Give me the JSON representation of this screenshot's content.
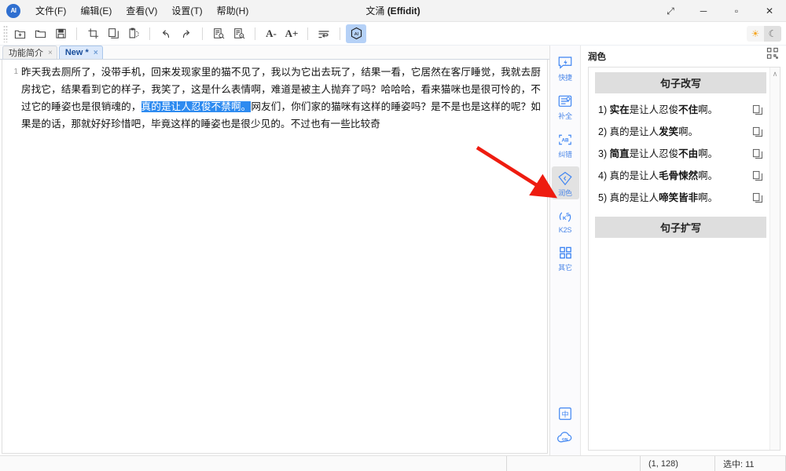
{
  "window": {
    "title_cn": "文涌",
    "title_en": "(Effidit)",
    "logo_text": "AI",
    "controls": {
      "expand": "⤢",
      "minimize": "─",
      "maximize": "▫",
      "close": "✕"
    }
  },
  "menubar": {
    "items": [
      {
        "label": "文件(F)"
      },
      {
        "label": "编辑(E)"
      },
      {
        "label": "查看(V)"
      },
      {
        "label": "设置(T)"
      },
      {
        "label": "帮助(H)"
      }
    ]
  },
  "toolbar": {
    "buttons": [
      {
        "name": "new-file-icon",
        "glyph": "icon-newfile"
      },
      {
        "name": "open-folder-icon",
        "glyph": "icon-open"
      },
      {
        "name": "save-icon",
        "glyph": "icon-save"
      },
      {
        "name": "cut-icon",
        "glyph": "icon-cut"
      },
      {
        "name": "copy-icon",
        "glyph": "icon-copy"
      },
      {
        "name": "paste-icon",
        "glyph": "icon-paste"
      },
      {
        "name": "undo-icon",
        "glyph": "icon-undo"
      },
      {
        "name": "redo-icon",
        "glyph": "icon-redo"
      },
      {
        "name": "find-icon",
        "glyph": "icon-find"
      },
      {
        "name": "replace-icon",
        "glyph": "icon-replace"
      },
      {
        "name": "font-decrease-icon",
        "glyph": "A-"
      },
      {
        "name": "font-increase-icon",
        "glyph": "A+"
      },
      {
        "name": "wrap-text-icon",
        "glyph": "icon-wrap"
      },
      {
        "name": "ai-assist-icon",
        "glyph": "icon-ai"
      }
    ],
    "theme": {
      "light": "☀",
      "dark": "☾"
    },
    "qr_corner": "qr-icon"
  },
  "tabs": [
    {
      "label": "功能简介",
      "active": false,
      "dirty": false,
      "close": "×"
    },
    {
      "label": "New *",
      "active": true,
      "dirty": true,
      "close": "×"
    }
  ],
  "editor": {
    "line_number": "1",
    "paragraph": {
      "before_selection": "昨天我去厕所了，没带手机，回来发现家里的猫不见了，我以为它出去玩了，结果一看，它居然在客厅睡觉，我就去厨房找它，结果看到它的样子，我笑了，这是什么表情啊，难道是被主人抛弃了吗？哈哈哈，看来猫咪也是很可怜的，不过它的睡姿也是很销魂的，",
      "selection": "真的是让人忍俊不禁啊。",
      "after_selection": "网友们，你们家的猫咪有这样的睡姿吗？是不是也是这样的呢？如果是的话，那就好好珍惜吧，毕竟这样的睡姿也是很少见的。不过也有一些比较奇"
    },
    "selection_color": "#2e8bf0"
  },
  "right_rail": {
    "items": [
      {
        "label": "快捷",
        "icon": "lightning-card-icon",
        "active": false
      },
      {
        "label": "补全",
        "icon": "autocomplete-icon",
        "active": false
      },
      {
        "label": "纠错",
        "icon": "spellcheck-icon",
        "active": false
      },
      {
        "label": "润色",
        "icon": "polish-diamond-icon",
        "active": true
      },
      {
        "label": "K2S",
        "icon": "k2s-icon",
        "active": false
      },
      {
        "label": "其它",
        "icon": "grid-other-icon",
        "active": false
      }
    ],
    "bottom_items": [
      {
        "name": "language-chinese-icon",
        "label": "中"
      },
      {
        "name": "cloud-on-icon",
        "label": "ON"
      }
    ]
  },
  "panel": {
    "title": "润色",
    "sections": [
      {
        "heading": "句子改写"
      },
      {
        "heading": "句子扩写"
      }
    ],
    "suggestions": [
      {
        "index": "1)",
        "pre": "",
        "bold1": "实在",
        "mid": "是让人忍俊",
        "bold2": "不住",
        "post": "啊。",
        "copy": "copy-icon"
      },
      {
        "index": "2)",
        "pre": "真的是让人",
        "bold1": "",
        "mid": "",
        "bold2": "发笑",
        "post": "啊。",
        "copy": "copy-icon"
      },
      {
        "index": "3)",
        "pre": "",
        "bold1": "简直",
        "mid": "是让人忍俊",
        "bold2": "不由",
        "post": "啊。",
        "copy": "copy-icon"
      },
      {
        "index": "4)",
        "pre": "真的是让人",
        "bold1": "",
        "mid": "",
        "bold2": "毛骨悚然",
        "post": "啊。",
        "copy": "copy-icon"
      },
      {
        "index": "5)",
        "pre": "真的是让人",
        "bold1": "",
        "mid": "",
        "bold2": "啼笑皆非",
        "post": "啊。",
        "copy": "copy-icon"
      }
    ],
    "scroll_arrow": "∧"
  },
  "statusbar": {
    "cursor_position": "(1, 128)",
    "selection_count": "选中: 11"
  },
  "annotation": {
    "arrow_color": "#ee1c10",
    "points_to": "润色"
  }
}
